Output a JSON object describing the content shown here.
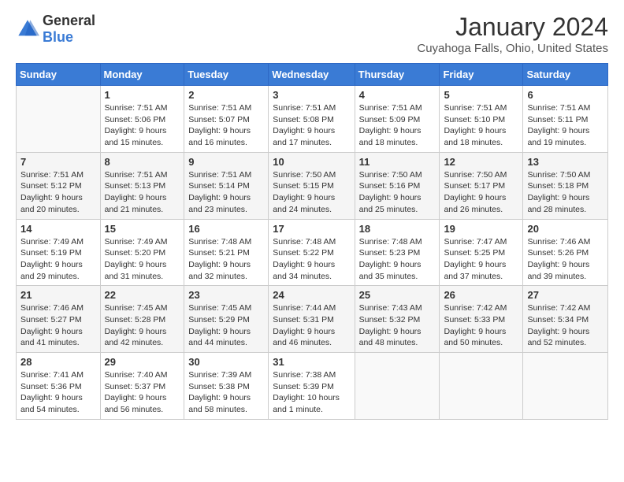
{
  "logo": {
    "text_general": "General",
    "text_blue": "Blue"
  },
  "header": {
    "month": "January 2024",
    "location": "Cuyahoga Falls, Ohio, United States"
  },
  "days_of_week": [
    "Sunday",
    "Monday",
    "Tuesday",
    "Wednesday",
    "Thursday",
    "Friday",
    "Saturday"
  ],
  "weeks": [
    [
      {
        "day": "",
        "empty": true
      },
      {
        "day": "1",
        "sunrise": "7:51 AM",
        "sunset": "5:06 PM",
        "daylight": "9 hours and 15 minutes."
      },
      {
        "day": "2",
        "sunrise": "7:51 AM",
        "sunset": "5:07 PM",
        "daylight": "9 hours and 16 minutes."
      },
      {
        "day": "3",
        "sunrise": "7:51 AM",
        "sunset": "5:08 PM",
        "daylight": "9 hours and 17 minutes."
      },
      {
        "day": "4",
        "sunrise": "7:51 AM",
        "sunset": "5:09 PM",
        "daylight": "9 hours and 18 minutes."
      },
      {
        "day": "5",
        "sunrise": "7:51 AM",
        "sunset": "5:10 PM",
        "daylight": "9 hours and 18 minutes."
      },
      {
        "day": "6",
        "sunrise": "7:51 AM",
        "sunset": "5:11 PM",
        "daylight": "9 hours and 19 minutes."
      }
    ],
    [
      {
        "day": "7",
        "sunrise": "7:51 AM",
        "sunset": "5:12 PM",
        "daylight": "9 hours and 20 minutes."
      },
      {
        "day": "8",
        "sunrise": "7:51 AM",
        "sunset": "5:13 PM",
        "daylight": "9 hours and 21 minutes."
      },
      {
        "day": "9",
        "sunrise": "7:51 AM",
        "sunset": "5:14 PM",
        "daylight": "9 hours and 23 minutes."
      },
      {
        "day": "10",
        "sunrise": "7:50 AM",
        "sunset": "5:15 PM",
        "daylight": "9 hours and 24 minutes."
      },
      {
        "day": "11",
        "sunrise": "7:50 AM",
        "sunset": "5:16 PM",
        "daylight": "9 hours and 25 minutes."
      },
      {
        "day": "12",
        "sunrise": "7:50 AM",
        "sunset": "5:17 PM",
        "daylight": "9 hours and 26 minutes."
      },
      {
        "day": "13",
        "sunrise": "7:50 AM",
        "sunset": "5:18 PM",
        "daylight": "9 hours and 28 minutes."
      }
    ],
    [
      {
        "day": "14",
        "sunrise": "7:49 AM",
        "sunset": "5:19 PM",
        "daylight": "9 hours and 29 minutes."
      },
      {
        "day": "15",
        "sunrise": "7:49 AM",
        "sunset": "5:20 PM",
        "daylight": "9 hours and 31 minutes."
      },
      {
        "day": "16",
        "sunrise": "7:48 AM",
        "sunset": "5:21 PM",
        "daylight": "9 hours and 32 minutes."
      },
      {
        "day": "17",
        "sunrise": "7:48 AM",
        "sunset": "5:22 PM",
        "daylight": "9 hours and 34 minutes."
      },
      {
        "day": "18",
        "sunrise": "7:48 AM",
        "sunset": "5:23 PM",
        "daylight": "9 hours and 35 minutes."
      },
      {
        "day": "19",
        "sunrise": "7:47 AM",
        "sunset": "5:25 PM",
        "daylight": "9 hours and 37 minutes."
      },
      {
        "day": "20",
        "sunrise": "7:46 AM",
        "sunset": "5:26 PM",
        "daylight": "9 hours and 39 minutes."
      }
    ],
    [
      {
        "day": "21",
        "sunrise": "7:46 AM",
        "sunset": "5:27 PM",
        "daylight": "9 hours and 41 minutes."
      },
      {
        "day": "22",
        "sunrise": "7:45 AM",
        "sunset": "5:28 PM",
        "daylight": "9 hours and 42 minutes."
      },
      {
        "day": "23",
        "sunrise": "7:45 AM",
        "sunset": "5:29 PM",
        "daylight": "9 hours and 44 minutes."
      },
      {
        "day": "24",
        "sunrise": "7:44 AM",
        "sunset": "5:31 PM",
        "daylight": "9 hours and 46 minutes."
      },
      {
        "day": "25",
        "sunrise": "7:43 AM",
        "sunset": "5:32 PM",
        "daylight": "9 hours and 48 minutes."
      },
      {
        "day": "26",
        "sunrise": "7:42 AM",
        "sunset": "5:33 PM",
        "daylight": "9 hours and 50 minutes."
      },
      {
        "day": "27",
        "sunrise": "7:42 AM",
        "sunset": "5:34 PM",
        "daylight": "9 hours and 52 minutes."
      }
    ],
    [
      {
        "day": "28",
        "sunrise": "7:41 AM",
        "sunset": "5:36 PM",
        "daylight": "9 hours and 54 minutes."
      },
      {
        "day": "29",
        "sunrise": "7:40 AM",
        "sunset": "5:37 PM",
        "daylight": "9 hours and 56 minutes."
      },
      {
        "day": "30",
        "sunrise": "7:39 AM",
        "sunset": "5:38 PM",
        "daylight": "9 hours and 58 minutes."
      },
      {
        "day": "31",
        "sunrise": "7:38 AM",
        "sunset": "5:39 PM",
        "daylight": "10 hours and 1 minute."
      },
      {
        "day": "",
        "empty": true
      },
      {
        "day": "",
        "empty": true
      },
      {
        "day": "",
        "empty": true
      }
    ]
  ],
  "labels": {
    "sunrise": "Sunrise:",
    "sunset": "Sunset:",
    "daylight": "Daylight:"
  }
}
